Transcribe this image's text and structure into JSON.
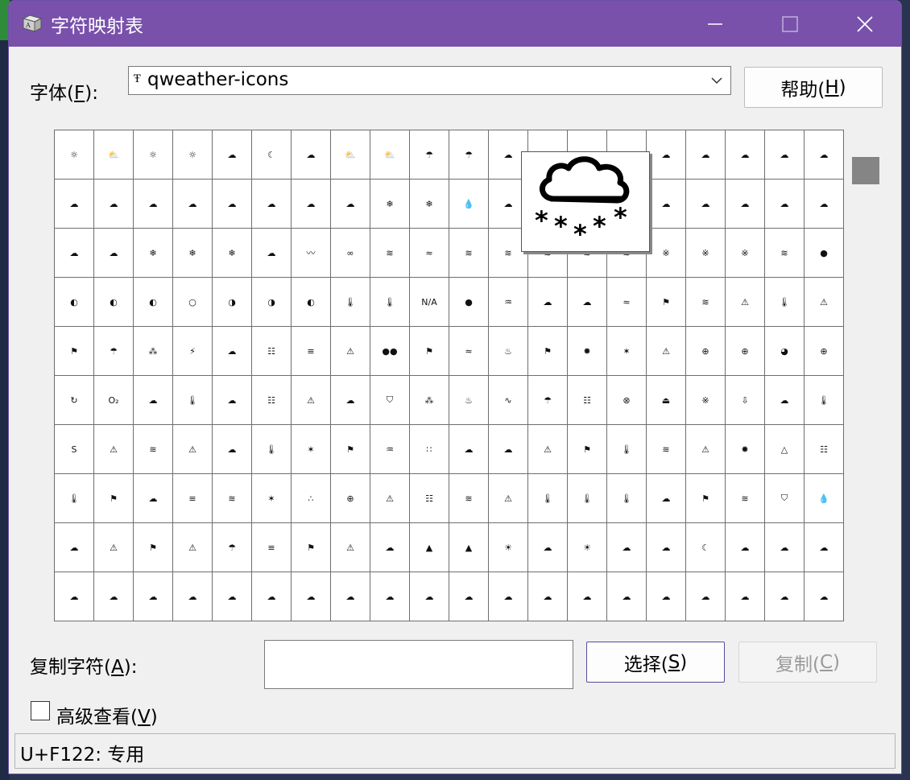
{
  "window": {
    "title": "字符映射表",
    "accent_color": "#7951ab"
  },
  "font_row": {
    "label_pre": "字体(",
    "label_key": "F",
    "label_post": "):",
    "selected_font": "qweather-icons",
    "font_type_icon": "truetype-icon"
  },
  "help_button": {
    "pre": "帮助(",
    "key": "H",
    "post": ")"
  },
  "char_grid": {
    "rows": [
      [
        "☼",
        "⛅",
        "☼",
        "☼",
        "☁",
        "☾",
        "☁",
        "⛅",
        "⛅",
        "☂",
        "☂",
        "☁",
        "☁",
        "☁",
        "☁",
        "☁",
        "☁",
        "☁",
        "☁",
        "☁"
      ],
      [
        "☁",
        "☁",
        "☁",
        "☁",
        "☁",
        "☁",
        "☁",
        "☁",
        "❄",
        "❄",
        "💧",
        "☁",
        "☁",
        "☁",
        "☁",
        "☁",
        "☁",
        "☁",
        "☁",
        "☁"
      ],
      [
        "☁",
        "☁",
        "❄",
        "❄",
        "❄",
        "☁",
        "〰",
        "∞",
        "≋",
        "≈",
        "≋",
        "≋",
        "≋",
        "≋",
        "≋",
        "※",
        "※",
        "※",
        "≋",
        "●"
      ],
      [
        "◐",
        "◐",
        "◐",
        "○",
        "◑",
        "◑",
        "◐",
        "🌡",
        "🌡",
        "N/A",
        "●",
        "♒",
        "☁",
        "☁",
        "≈",
        "⚑",
        "≋",
        "⚠",
        "🌡",
        "⚠"
      ],
      [
        "⚑",
        "☂",
        "⁂",
        "⚡",
        "☁",
        "☷",
        "≡",
        "⚠",
        "●●",
        "⚑",
        "≈",
        "♨",
        "⚑",
        "✹",
        "✶",
        "⚠",
        "⊕",
        "⊕",
        "◕",
        "⊕"
      ],
      [
        "↻",
        "O₂",
        "☁",
        "🌡",
        "☁",
        "☷",
        "⚠",
        "☁",
        "⛉",
        "⁂",
        "♨",
        "∿",
        "☂",
        "☷",
        "⊗",
        "⏏",
        "※",
        "⇩",
        "☁",
        "🌡"
      ],
      [
        "S",
        "⚠",
        "≋",
        "⚠",
        "☁",
        "🌡",
        "✶",
        "⚑",
        "♒",
        "∷",
        "☁",
        "☁",
        "⚠",
        "⚑",
        "🌡",
        "≋",
        "⚠",
        "✹",
        "△",
        "☷"
      ],
      [
        "🌡",
        "⚑",
        "☁",
        "≡",
        "≋",
        "✶",
        "∴",
        "⊕",
        "⚠",
        "☷",
        "≋",
        "⚠",
        "🌡",
        "🌡",
        "🌡",
        "☁",
        "⚑",
        "≋",
        "⛉",
        "💧"
      ],
      [
        "☁",
        "⚠",
        "⚑",
        "⚠",
        "☂",
        "≡",
        "⚑",
        "⚠",
        "☁",
        "▲",
        "▲",
        "☀",
        "☁",
        "☀",
        "☁",
        "☁",
        "☾",
        "☁",
        "☁",
        "☁"
      ],
      [
        "☁",
        "☁",
        "☁",
        "☁",
        "☁",
        "☁",
        "☁",
        "☁",
        "☁",
        "☁",
        "☁",
        "☁",
        "☁",
        "☁",
        "☁",
        "☁",
        "☁",
        "☁",
        "☁",
        "☁"
      ]
    ],
    "selected": {
      "row": 0,
      "col": 13
    },
    "zoom_icon": "cloud-snow-icon"
  },
  "copy_row": {
    "label_pre": "复制字符(",
    "label_key": "A",
    "label_post": "):",
    "value": "",
    "select_button": {
      "pre": "选择(",
      "key": "S",
      "post": ")"
    },
    "copy_button": {
      "pre": "复制(",
      "key": "C",
      "post": ")"
    }
  },
  "advanced": {
    "label_pre": "高级查看(",
    "label_key": "V",
    "label_post": ")",
    "checked": false
  },
  "status": {
    "text": "U+F122: 专用"
  }
}
